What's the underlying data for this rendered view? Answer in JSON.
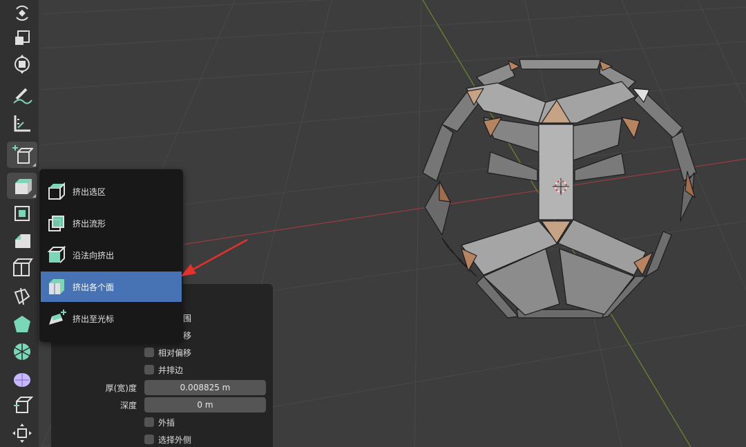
{
  "toolbar": {
    "tools": [
      "rotate-icon",
      "scale-icon",
      "transform-icon",
      "annotate-icon",
      "measure-icon",
      "add-cube-icon",
      "extrude-region-icon",
      "inset-faces-icon",
      "bevel-icon",
      "loop-cut-icon",
      "knife-icon",
      "poly-build-icon",
      "spin-icon",
      "smooth-icon",
      "edge-slide-icon",
      "shrink-fatten-icon"
    ]
  },
  "extrude_menu": {
    "items": [
      {
        "label": "挤出选区",
        "icon": "extrude-region-icon"
      },
      {
        "label": "挤出流形",
        "icon": "extrude-manifold-icon"
      },
      {
        "label": "沿法向挤出",
        "icon": "extrude-along-normals-icon"
      },
      {
        "label": "挤出各个面",
        "icon": "extrude-individual-icon",
        "highlighted": true
      },
      {
        "label": "挤出至光标",
        "icon": "extrude-to-cursor-icon"
      }
    ]
  },
  "operator_panel": {
    "options": [
      {
        "label": "边界范围",
        "visible_label": "围",
        "checked": true,
        "obscured": true
      },
      {
        "label": "均等偏移",
        "visible_label": "移",
        "checked": true,
        "obscured": true
      },
      {
        "label": "相对偏移",
        "checked": false
      },
      {
        "label": "并排边",
        "checked": false
      }
    ],
    "fields": [
      {
        "label": "厚(宽)度",
        "value": "0.008825 m"
      },
      {
        "label": "深度",
        "value": "0 m"
      }
    ],
    "options2": [
      {
        "label": "外插",
        "checked": false
      },
      {
        "label": "选择外侧",
        "checked": false
      }
    ]
  },
  "colors": {
    "background": "#3d3d3d",
    "grid": "#4a4a4a",
    "x_axis": "#9a3c45",
    "y_axis": "#6c8a2a",
    "mesh_face": "#a4a4a4",
    "mesh_face_selected": "#c7a385",
    "menu_highlight": "#4772b3",
    "arrow": "#e5312b"
  }
}
